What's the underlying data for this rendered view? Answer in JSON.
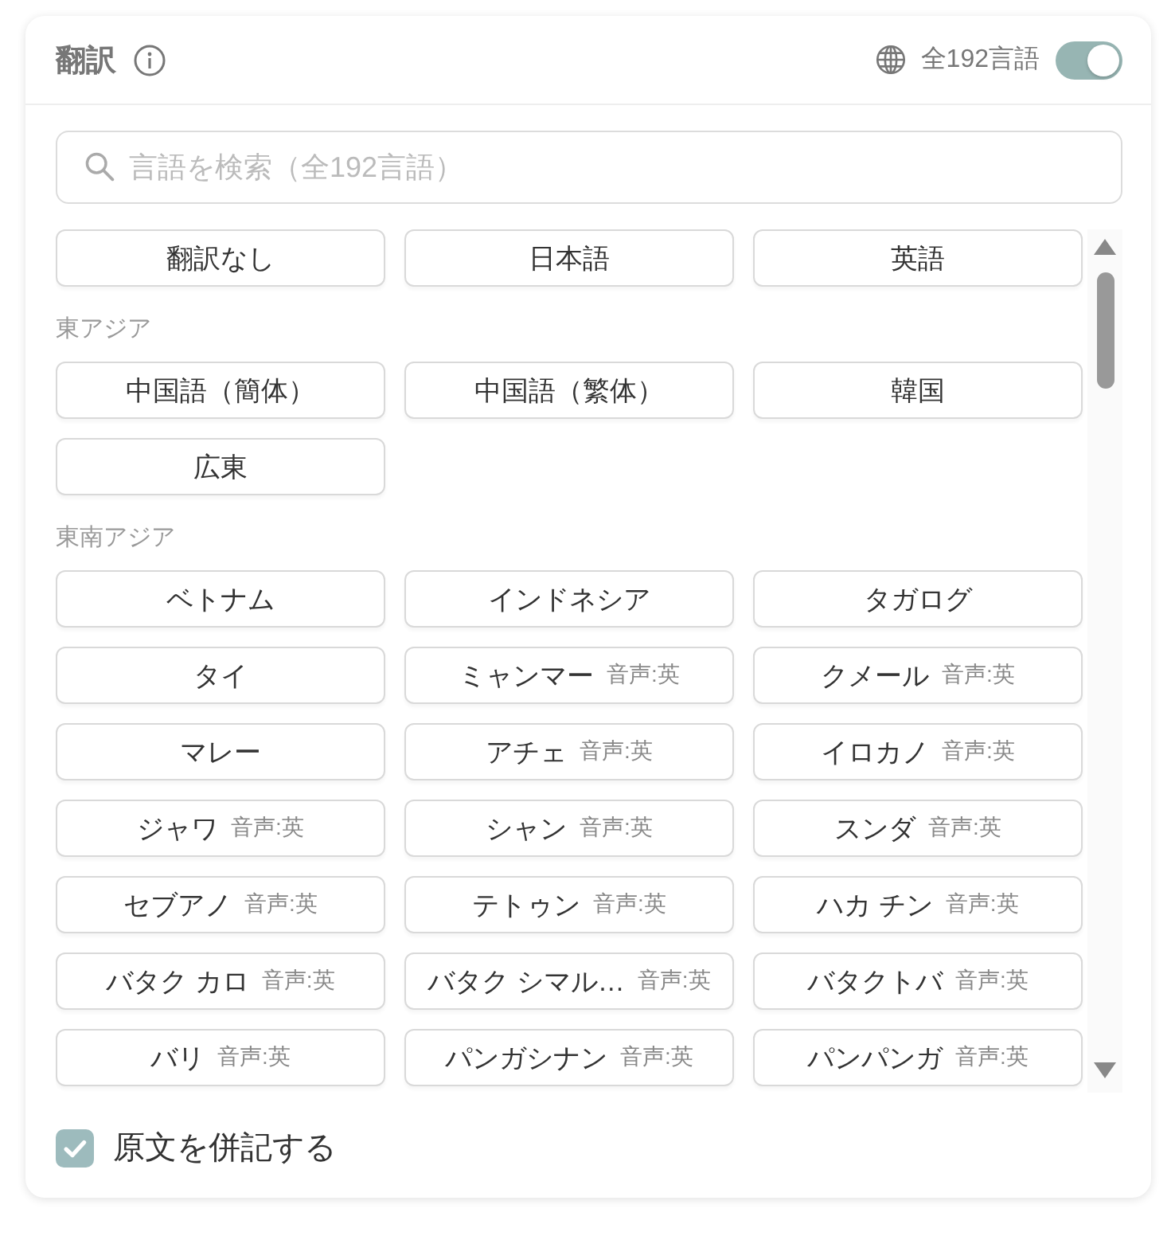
{
  "header": {
    "title": "翻訳",
    "language_count": "全192言語",
    "all_languages_toggle": {
      "on": true
    }
  },
  "search": {
    "placeholder": "言語を検索（全192言語）"
  },
  "quick_options": [
    {
      "label": "翻訳なし",
      "selected": false
    },
    {
      "label": "日本語",
      "selected": false
    },
    {
      "label": "英語",
      "selected": false
    }
  ],
  "groups": [
    {
      "heading": "東アジア",
      "languages": [
        {
          "label": "中国語（簡体）",
          "selected": false
        },
        {
          "label": "中国語（繁体）",
          "selected": false
        },
        {
          "label": "韓国",
          "selected": false
        },
        {
          "label": "広東",
          "selected": false
        }
      ]
    },
    {
      "heading": "東南アジア",
      "languages": [
        {
          "label": "ベトナム",
          "selected": false
        },
        {
          "label": "インドネシア",
          "selected": false
        },
        {
          "label": "タガログ",
          "selected": false
        },
        {
          "label": "タイ",
          "selected": false
        },
        {
          "label": "ミャンマー",
          "note": "音声:英",
          "selected": false
        },
        {
          "label": "クメール",
          "note": "音声:英",
          "selected": false
        },
        {
          "label": "マレー",
          "selected": false
        },
        {
          "label": "アチェ",
          "note": "音声:英",
          "selected": false
        },
        {
          "label": "イロカノ",
          "note": "音声:英",
          "selected": false
        },
        {
          "label": "ジャワ",
          "note": "音声:英",
          "selected": false
        },
        {
          "label": "シャン",
          "note": "音声:英",
          "selected": false
        },
        {
          "label": "スンダ",
          "note": "音声:英",
          "selected": false
        },
        {
          "label": "セブアノ",
          "note": "音声:英",
          "selected": false
        },
        {
          "label": "テトゥン",
          "note": "音声:英",
          "selected": false
        },
        {
          "label": "ハカ チン",
          "note": "音声:英",
          "selected": false
        },
        {
          "label": "バタク カロ",
          "note": "音声:英",
          "selected": false
        },
        {
          "label": "バタク シマル…",
          "note": "音声:英",
          "selected": false
        },
        {
          "label": "バタクトバ",
          "note": "音声:英",
          "selected": false
        },
        {
          "label": "バリ",
          "note": "音声:英",
          "selected": false
        },
        {
          "label": "パンガシナン",
          "note": "音声:英",
          "selected": false
        },
        {
          "label": "パンパンガ",
          "note": "音声:英",
          "selected": false
        }
      ]
    }
  ],
  "show_original": {
    "label": "原文を併記する",
    "checked": true
  }
}
